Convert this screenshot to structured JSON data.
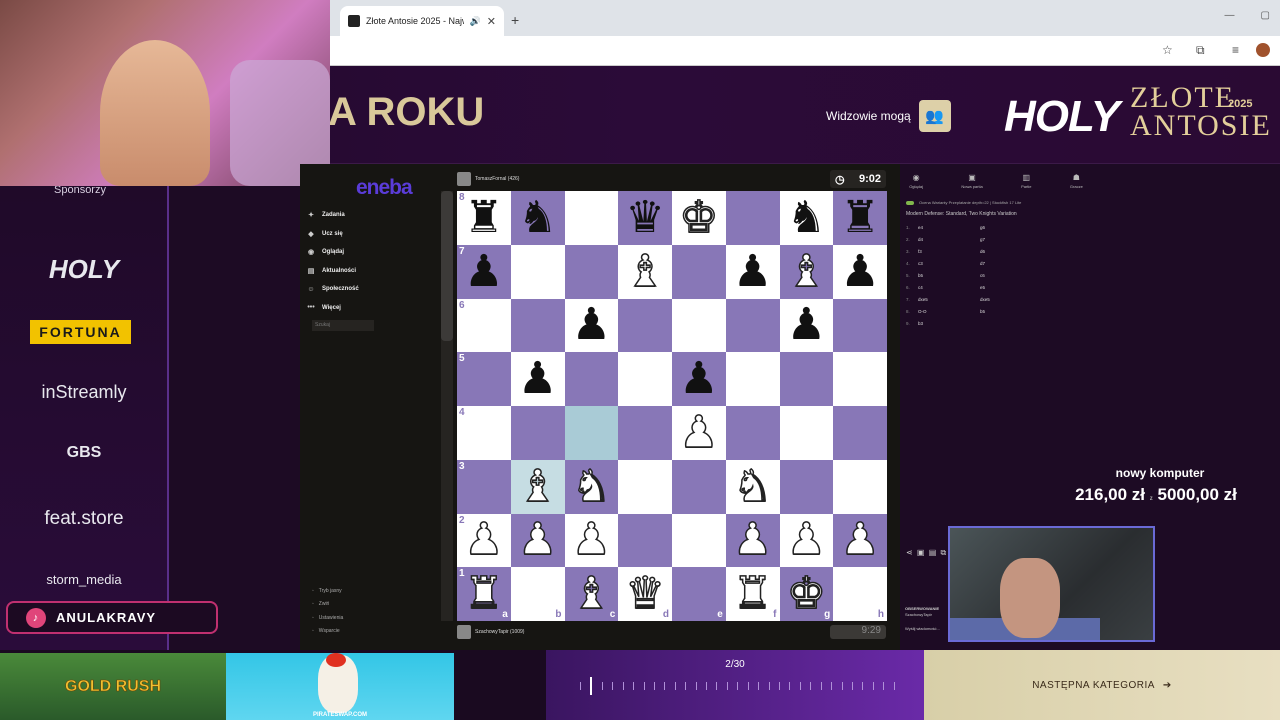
{
  "browser": {
    "tab_title": "Złote Antosie 2025 - Najwi",
    "new_tab": "+",
    "close": "✕",
    "minimize": "—",
    "maximize": "▢"
  },
  "banner": {
    "title_fragment": "A ROKU",
    "viewers_label": "Widzowie mogą",
    "logo_brand": "HOLY",
    "logo_event": "ZŁOTE ANTOSIE",
    "logo_year": "2025"
  },
  "sponsors": {
    "heading": "Sponsorzy",
    "items": [
      "HOLY",
      "FORTUNA",
      "inStreamly",
      "GBS",
      "feat.store",
      "storm_media"
    ],
    "handle": "ANULAKRAVY"
  },
  "chess_site": {
    "brand": "eneba",
    "nav": [
      {
        "icon": "puzzle",
        "label": "Zadania"
      },
      {
        "icon": "learn",
        "label": "Ucz się"
      },
      {
        "icon": "watch",
        "label": "Oglądaj"
      },
      {
        "icon": "news",
        "label": "Aktualności"
      },
      {
        "icon": "social",
        "label": "Społeczność"
      },
      {
        "icon": "more",
        "label": "Więcej"
      }
    ],
    "search_placeholder": "Szukaj",
    "bottom_nav": [
      "Tryb jasny",
      "Zwiń",
      "Ustawienia",
      "Wsparcie"
    ],
    "top_player": "TomaszFornal (426)",
    "bottom_player": "SzachowyTapir (1009)",
    "top_clock": "9:02",
    "bottom_clock": "9:29",
    "ranks": [
      "8",
      "7",
      "6",
      "5",
      "4",
      "3",
      "2",
      "1"
    ],
    "files": [
      "a",
      "b",
      "c",
      "d",
      "e",
      "f",
      "g",
      "h"
    ],
    "board": [
      [
        "br",
        "bn",
        "",
        "bq",
        "wk",
        "",
        "bn",
        "br"
      ],
      [
        "bp",
        "",
        "",
        "wb",
        "",
        "bp",
        "wb",
        "bp"
      ],
      [
        "",
        "",
        "bp",
        "",
        "",
        "",
        "bp",
        ""
      ],
      [
        "",
        "bp",
        "",
        "",
        "bp",
        "",
        "",
        ""
      ],
      [
        "",
        "",
        "hl",
        "",
        "wp",
        "",
        "",
        ""
      ],
      [
        "",
        "wb",
        "wn",
        "",
        "",
        "wn",
        "",
        ""
      ],
      [
        "wp",
        "wp",
        "wp",
        "",
        "",
        "wp",
        "wp",
        "wp"
      ],
      [
        "wr",
        "",
        "wb",
        "wq",
        "",
        "wr",
        "wk",
        ""
      ]
    ]
  },
  "analysis": {
    "tabs": [
      "Oglądaj",
      "Nowa partia",
      "Partie",
      "Gracze"
    ],
    "options": "Ocena   Warianty   Przeplatanie   depth=22 | Stockfish 17 Lite",
    "opening": "Modern Defense: Standard, Two Knights Variation",
    "moves": [
      {
        "n": "1.",
        "w": "e4",
        "b": "g6"
      },
      {
        "n": "2.",
        "w": "d4",
        "b": "g7"
      },
      {
        "n": "3.",
        "w": "f3",
        "b": "d6"
      },
      {
        "n": "4.",
        "w": "c3",
        "b": "d7"
      },
      {
        "n": "5.",
        "w": "b5",
        "b": "c6"
      },
      {
        "n": "6.",
        "w": "c4",
        "b": "e5"
      },
      {
        "n": "7.",
        "w": "dxe5",
        "b": "dxe5"
      },
      {
        "n": "8.",
        "w": "O-O",
        "b": "b5"
      },
      {
        "n": "9.",
        "w": "b3",
        "b": ""
      }
    ]
  },
  "donation": {
    "title": "nowy komputer",
    "current": "216,00 zł",
    "separator": "z",
    "goal": "5000,00 zł"
  },
  "streamer": {
    "observing": "OBSERWOWANIE",
    "name": "SzachowyTapir",
    "footer": "Wyślij wiadomość..."
  },
  "ads": {
    "gold_rush": "GOLD RUSH",
    "pirateswap": "PIRATESWAP.COM"
  },
  "progress": {
    "label": "2/30",
    "value": 0.033
  },
  "next_category": "NASTĘPNA KATEGORIA"
}
